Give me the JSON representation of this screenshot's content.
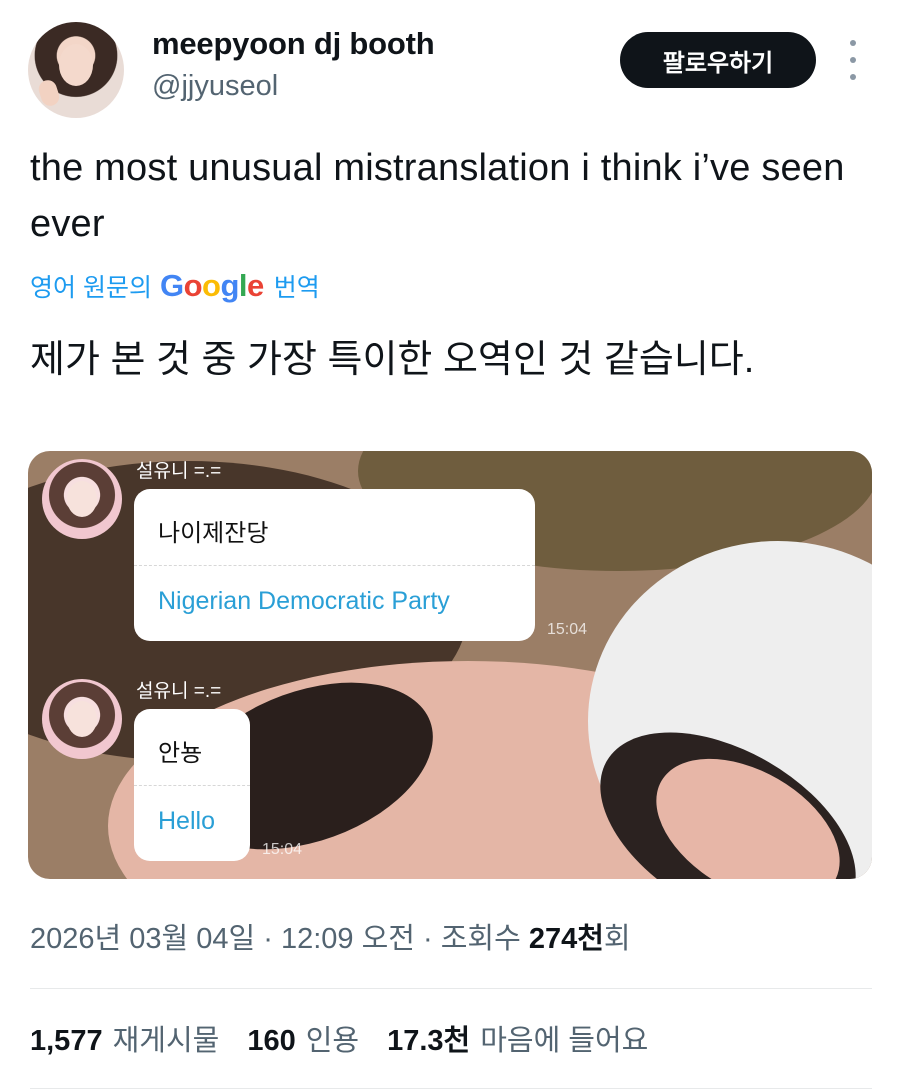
{
  "author": {
    "display_name": "meepyoon dj booth",
    "handle": "@jjyuseol"
  },
  "follow_button_label": "팔로우하기",
  "tweet_text": "the most unusual mistranslation i think i’ve seen ever",
  "translation": {
    "prefix": "영어 원문의",
    "brand": "Google",
    "suffix": "번역",
    "text": "제가 본 것 중 가장 특이한 오역인 것 같습니다."
  },
  "media": {
    "messages": [
      {
        "sender": "설유니 =.=",
        "original": "나이제잔당",
        "translation": "Nigerian Democratic Party",
        "time": "15:04"
      },
      {
        "sender": "설유니 =.=",
        "original": "안뇽",
        "translation": "Hello",
        "time": "15:04"
      }
    ]
  },
  "meta": {
    "datetime": "2026년 03월 04일 · 12:09 오전 · 조회수 ",
    "views": "274천",
    "views_suffix": "회"
  },
  "stats": [
    {
      "value": "1,577",
      "label": "재게시물"
    },
    {
      "value": "160",
      "label": "인용"
    },
    {
      "value": "17.3천",
      "label": "마음에 들어요"
    }
  ],
  "colors": {
    "link_blue": "#1d9bf0",
    "chat_translation_blue": "#2a9fd6",
    "secondary_text": "#536471",
    "button_bg": "#0f1419"
  }
}
